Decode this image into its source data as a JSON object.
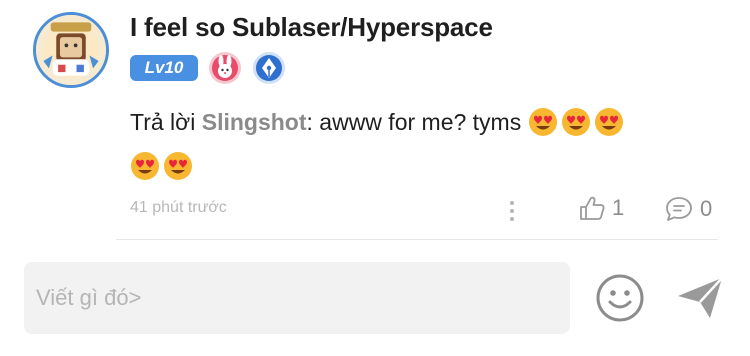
{
  "comment": {
    "username": "I feel so Sublaser/Hyperspace",
    "level": "Lv10",
    "reply_prefix": "Trả lời ",
    "mention": "Slingshot",
    "text": ": awww for me? tyms ",
    "emojis_count": 5,
    "emoji_icon": "heart-eyes-emoji",
    "time": "41 phút trước",
    "likes": "1",
    "replies": "0",
    "colors": {
      "level_badge": "#4a90e2",
      "mention": "#8a8a8a",
      "meta": "#b8b8b8"
    }
  },
  "composer": {
    "placeholder": "Viết gì đó>"
  }
}
